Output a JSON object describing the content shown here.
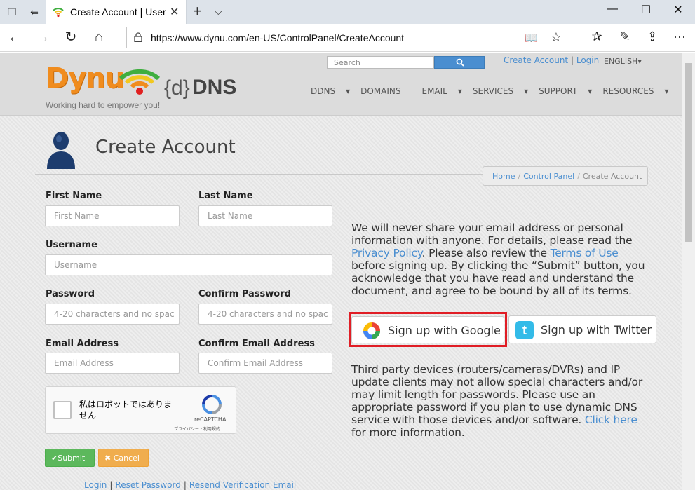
{
  "browser": {
    "tab_title": "Create Account | User C",
    "url": "https://www.dynu.com/en-US/ControlPanel/CreateAccount"
  },
  "header": {
    "brand": "Dynu",
    "ddns_brace": "{d}",
    "ddns_bold": "DNS",
    "tagline": "Working hard to empower you!",
    "search_placeholder": "Search",
    "create_account_link": "Create Account",
    "login_link": "Login",
    "language": "ENGLISH",
    "nav": [
      "DDNS",
      "DOMAINS",
      "EMAIL",
      "SERVICES",
      "SUPPORT",
      "RESOURCES"
    ]
  },
  "page": {
    "title": "Create Account",
    "breadcrumb": [
      "Home",
      "Control Panel",
      "Create Account"
    ]
  },
  "form": {
    "first_name": {
      "label": "First Name",
      "placeholder": "First Name"
    },
    "last_name": {
      "label": "Last Name",
      "placeholder": "Last Name"
    },
    "username": {
      "label": "Username",
      "placeholder": "Username"
    },
    "password": {
      "label": "Password",
      "placeholder": "4-20 characters and no spac"
    },
    "confirm_password": {
      "label": "Confirm Password",
      "placeholder": "4-20 characters and no spac"
    },
    "email": {
      "label": "Email Address",
      "placeholder": "Email Address"
    },
    "confirm_email": {
      "label": "Confirm Email Address",
      "placeholder": "Confirm Email Address"
    },
    "recaptcha": {
      "text": "私はロボットではありません",
      "brand": "reCAPTCHA",
      "terms": "プライバシー・利用規約"
    },
    "submit": "Submit",
    "cancel": "Cancel",
    "bottom_links": [
      "Login",
      "Reset Password",
      "Resend Verification Email"
    ]
  },
  "info": {
    "privacy_pre": "We will never share your email address or personal information with anyone. For details, please read the ",
    "privacy_link": "Privacy Policy",
    "privacy_mid": ". Please also review the ",
    "terms_link": "Terms of Use",
    "privacy_post": " before signing up. By clicking the “Submit” button, you acknowledge that you have read and understand the document, and agree to be bound by all of its terms.",
    "google_button": "Sign up with Google",
    "twitter_button": "Sign up with Twitter",
    "third_party_pre": "Third party devices (routers/cameras/DVRs) and IP update clients may not allow special characters and/or may limit length for passwords. Please use an appropriate password if you plan to use dynamic DNS service with those devices and/or software. ",
    "click_here": "Click here",
    "third_party_post": " for more information."
  },
  "colors": {
    "link": "#4a8ed0",
    "brand_orange": "#f08c1e",
    "submit_green": "#5cb85c",
    "cancel_orange": "#f0ad4e",
    "highlight_red": "#e01e26"
  }
}
